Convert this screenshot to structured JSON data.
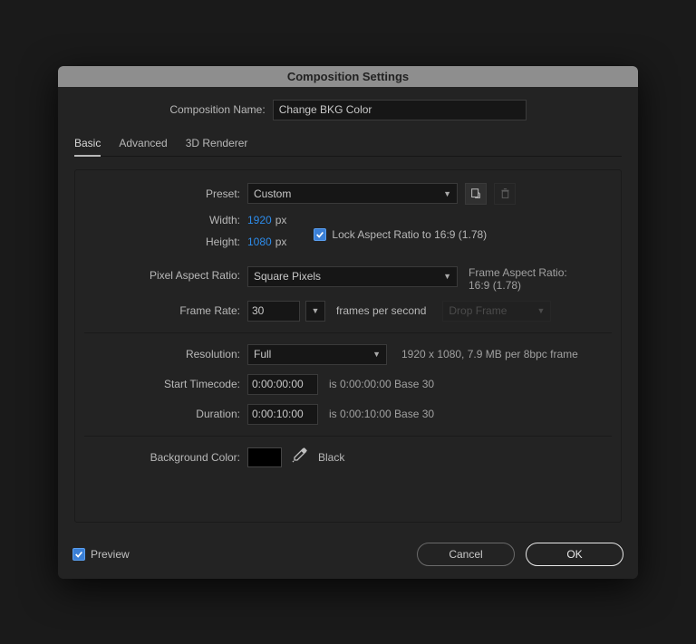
{
  "dialog_title": "Composition Settings",
  "comp_name_label": "Composition Name:",
  "comp_name_value": "Change BKG Color",
  "tabs": {
    "basic": "Basic",
    "advanced": "Advanced",
    "renderer": "3D Renderer"
  },
  "preset": {
    "label": "Preset:",
    "value": "Custom"
  },
  "dimensions": {
    "width_label": "Width:",
    "width_value": "1920",
    "height_label": "Height:",
    "height_value": "1080",
    "unit": "px",
    "lock_label": "Lock Aspect Ratio to 16:9 (1.78)"
  },
  "par": {
    "label": "Pixel Aspect Ratio:",
    "value": "Square Pixels",
    "aside_label": "Frame Aspect Ratio:",
    "aside_value": "16:9 (1.78)"
  },
  "framerate": {
    "label": "Frame Rate:",
    "value": "30",
    "unit": "frames per second",
    "drop_value": "Drop Frame"
  },
  "resolution": {
    "label": "Resolution:",
    "value": "Full",
    "info": "1920 x 1080, 7.9 MB per 8bpc frame"
  },
  "timecode": {
    "label": "Start Timecode:",
    "value": "0:00:00:00",
    "info": "is 0:00:00:00  Base 30"
  },
  "duration": {
    "label": "Duration:",
    "value": "0:00:10:00",
    "info": "is 0:00:10:00  Base 30"
  },
  "bgcolor": {
    "label": "Background Color:",
    "name": "Black",
    "hex": "#000000"
  },
  "footer": {
    "preview": "Preview",
    "cancel": "Cancel",
    "ok": "OK"
  }
}
